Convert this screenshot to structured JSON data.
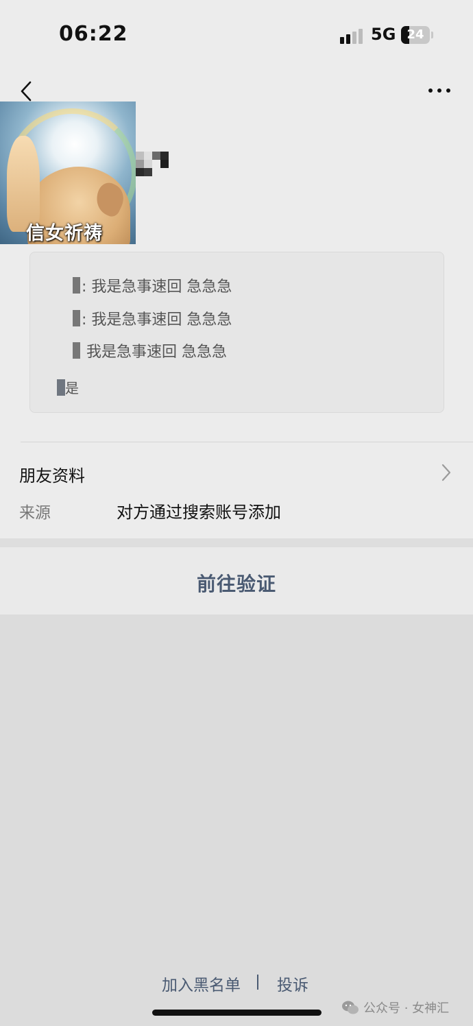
{
  "status_bar": {
    "time": "06:22",
    "network": "5G",
    "battery": "24"
  },
  "profile": {
    "avatar_caption": "信女祈祷",
    "messages": [
      ": 我是急事速回 急急急",
      ": 我是急事速回 急急急",
      "  我是急事速回 急急急"
    ],
    "message_tail": "是"
  },
  "friend_info": {
    "label": "朋友资料"
  },
  "source": {
    "label": "来源",
    "value": "对方通过搜索账号添加"
  },
  "verify": {
    "label": "前往验证"
  },
  "bottom_links": {
    "blacklist": "加入黑名单",
    "report": "投诉"
  },
  "watermark": {
    "text": "公众号 · 女神汇"
  },
  "colors": {
    "link": "#4a5a72",
    "background": "#ececec"
  }
}
